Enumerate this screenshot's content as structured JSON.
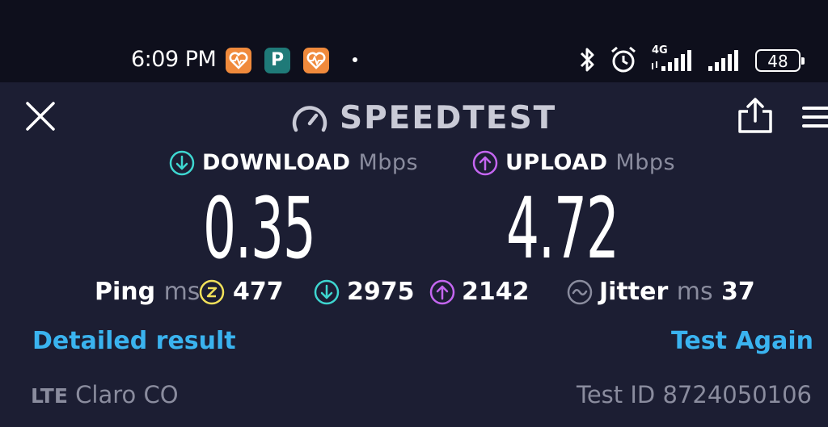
{
  "status_bar": {
    "time": "6:09 PM",
    "notification_icons": [
      "heart-app-icon",
      "parking-app-icon",
      "heart-app-icon"
    ],
    "network_label": "4G",
    "battery_level": "48"
  },
  "header": {
    "title": "SPEEDTEST",
    "close_icon": "close-icon",
    "share_icon": "share-icon",
    "menu_icon": "menu-icon"
  },
  "download": {
    "label": "DOWNLOAD",
    "unit": "Mbps",
    "value": "0.35",
    "color": "#3ed6d0"
  },
  "upload": {
    "label": "UPLOAD",
    "unit": "Mbps",
    "value": "4.72",
    "color": "#c466f0"
  },
  "stats": {
    "ping_label": "Ping",
    "ping_unit": "ms",
    "ping_idle": "477",
    "ping_download": "2975",
    "ping_upload": "2142",
    "jitter_label": "Jitter",
    "jitter_unit": "ms",
    "jitter_value": "37",
    "idle_color": "#f2e15a"
  },
  "actions": {
    "detailed_result": "Detailed result",
    "test_again": "Test Again"
  },
  "footer": {
    "connection_type": "LTE",
    "carrier": "Claro CO",
    "test_id_label": "Test ID",
    "test_id": "8724050106"
  }
}
